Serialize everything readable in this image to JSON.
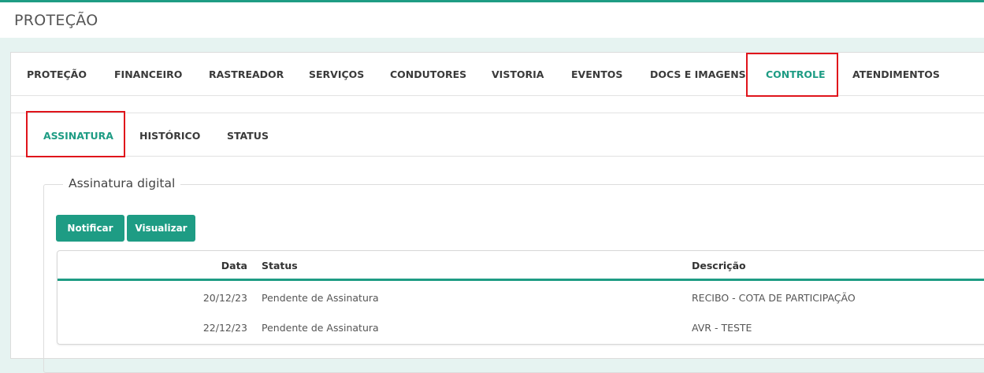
{
  "header": {
    "title": "PROTEÇÃO"
  },
  "main_tabs": [
    {
      "label": "PROTEÇÃO"
    },
    {
      "label": "FINANCEIRO"
    },
    {
      "label": "RASTREADOR"
    },
    {
      "label": "SERVIÇOS"
    },
    {
      "label": "CONDUTORES"
    },
    {
      "label": "VISTORIA"
    },
    {
      "label": "EVENTOS"
    },
    {
      "label": "DOCS E IMAGENS"
    },
    {
      "label": "CONTROLE"
    },
    {
      "label": "ATENDIMENTOS"
    }
  ],
  "active_main_tab": "CONTROLE",
  "sub_tabs": [
    {
      "label": "ASSINATURA"
    },
    {
      "label": "HISTÓRICO"
    },
    {
      "label": "STATUS"
    }
  ],
  "active_sub_tab": "ASSINATURA",
  "section": {
    "legend": "Assinatura digital",
    "notify_label": "Notificar",
    "view_label": "Visualizar"
  },
  "table": {
    "columns": {
      "date": "Data",
      "status": "Status",
      "description": "Descrição"
    },
    "rows": [
      {
        "date": "20/12/23",
        "status": "Pendente de Assinatura",
        "description": "RECIBO - COTA DE PARTICIPAÇÃO"
      },
      {
        "date": "22/12/23",
        "status": "Pendente de Assinatura",
        "description": "AVR - TESTE"
      }
    ]
  },
  "colors": {
    "accent": "#1e9c84",
    "highlight": "#e0141b",
    "background": "#e6f3f1"
  }
}
